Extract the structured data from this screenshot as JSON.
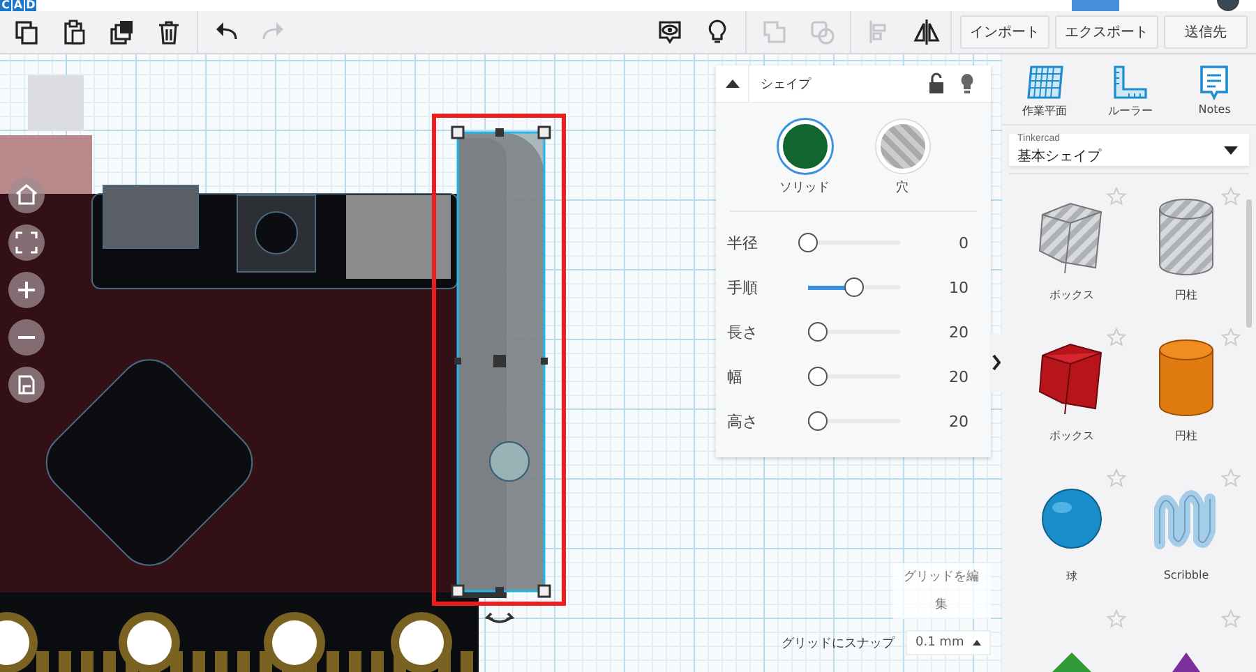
{
  "logo": {
    "letters": [
      "C",
      "A",
      "D"
    ]
  },
  "toolbar": {
    "tools": [
      {
        "disabled": false
      },
      {
        "disabled": false
      },
      {
        "disabled": false
      },
      {
        "disabled": false
      },
      {
        "disabled": false
      },
      {
        "disabled": true
      }
    ],
    "view_tools": [
      {
        "disabled": false
      },
      {
        "disabled": false
      },
      {
        "disabled": true
      },
      {
        "disabled": true
      },
      {
        "disabled": true
      },
      {
        "disabled": false
      }
    ],
    "buttons": [
      "インポート",
      "エクスポート",
      "送信先"
    ]
  },
  "inspector": {
    "title": "シェイプ",
    "modes": [
      {
        "label": "ソリッド",
        "kind": "solid",
        "selected": true
      },
      {
        "label": "穴",
        "kind": "hole",
        "selected": false
      }
    ],
    "params": [
      {
        "label": "半径",
        "level": 0,
        "reading": "0"
      },
      {
        "label": "手順",
        "level": 0.5,
        "reading": "10"
      },
      {
        "label": "長さ",
        "level": 0.1,
        "reading": "20"
      },
      {
        "label": "幅",
        "level": 0.1,
        "reading": "20"
      },
      {
        "label": "高さ",
        "level": 0.1,
        "reading": "20"
      }
    ]
  },
  "sidebar": {
    "tools": [
      {
        "label": "作業平面",
        "kind": "workplane"
      },
      {
        "label": "ルーラー",
        "kind": "ruler"
      },
      {
        "label": "Notes",
        "kind": "notes"
      }
    ],
    "library": {
      "source": "Tinkercad",
      "selection": "基本シェイプ"
    },
    "shapes": [
      {
        "label": "ボックス",
        "kind": "box-hole"
      },
      {
        "label": "円柱",
        "kind": "cylinder-hole"
      },
      {
        "label": "ボックス",
        "kind": "box"
      },
      {
        "label": "円柱",
        "kind": "cylinder"
      },
      {
        "label": "球",
        "kind": "sphere"
      },
      {
        "label": "Scribble",
        "kind": "scribble"
      },
      {
        "kind": "roof"
      },
      {
        "kind": "cone"
      }
    ]
  },
  "canvas": {
    "edit_grid": "グリッドを編集",
    "snap_label": "グリッドにスナップ",
    "snap_value": "0.1 mm"
  }
}
